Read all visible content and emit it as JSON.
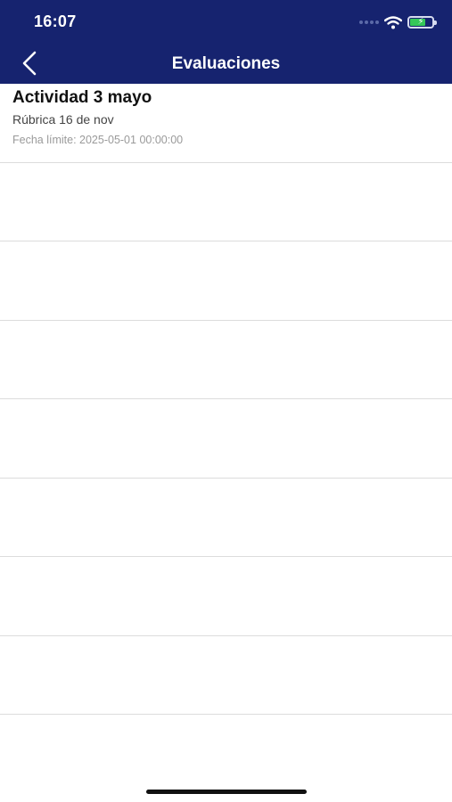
{
  "status_bar": {
    "time": "16:07",
    "icons": [
      "signal-dots-icon",
      "wifi-icon",
      "battery-charging-icon"
    ],
    "battery_color": "#35c759"
  },
  "nav": {
    "title": "Evaluaciones",
    "back_icon": "chevron-left-icon",
    "background_color": "#16236f"
  },
  "evaluations": [
    {
      "title": "Actividad 3 mayo",
      "subtitle": "Rúbrica 16 de nov",
      "deadline": "Fecha límite: 2025-05-01 00:00:00"
    }
  ]
}
